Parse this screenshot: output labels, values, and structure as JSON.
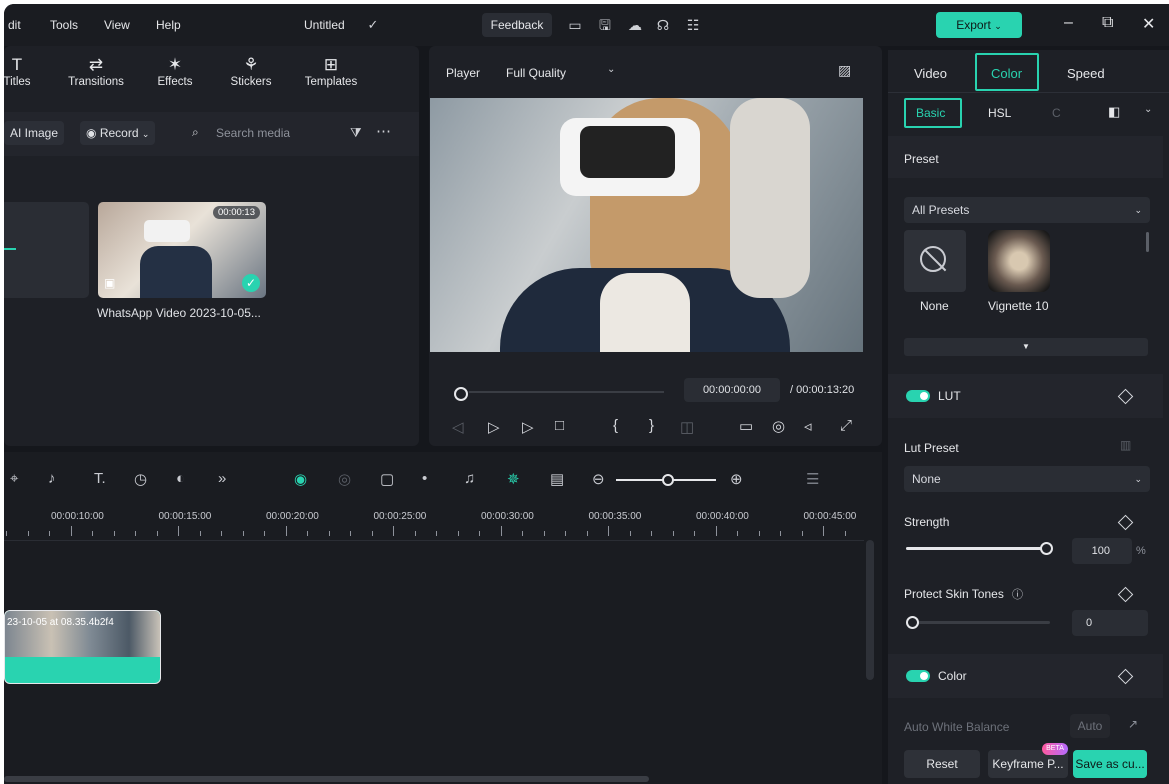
{
  "menu": {
    "edit": "dit",
    "tools": "Tools",
    "view": "View",
    "help": "Help",
    "title": "Untitled",
    "feedback": "Feedback",
    "export": "Export"
  },
  "toolbar": {
    "titles": "Titles",
    "transitions": "Transitions",
    "effects": "Effects",
    "stickers": "Stickers",
    "templates": "Templates"
  },
  "media": {
    "ai_image": "AI Image",
    "record": "Record",
    "search_placeholder": "Search media",
    "clip_name": "WhatsApp Video 2023-10-05...",
    "clip_duration": "00:00:13"
  },
  "player": {
    "label": "Player",
    "quality": "Full Quality",
    "current_time": "00:00:00:00",
    "total_time": "/ 00:00:13:20"
  },
  "timeline": {
    "ticks": [
      "00:00:10:00",
      "00:00:15:00",
      "00:00:20:00",
      "00:00:25:00",
      "00:00:30:00",
      "00:00:35:00",
      "00:00:40:00",
      "00:00:45:00"
    ],
    "clip_label": "23-10-05 at 08.35.4b2f4"
  },
  "right_panel": {
    "tabs": {
      "video": "Video",
      "color": "Color",
      "speed": "Speed"
    },
    "subtabs": {
      "basic": "Basic",
      "hsl": "HSL",
      "curves": "C"
    },
    "preset_title": "Preset",
    "all_presets": "All Presets",
    "preset_none": "None",
    "preset_vignette": "Vignette 10",
    "lut": "LUT",
    "lut_preset_label": "Lut Preset",
    "lut_preset_value": "None",
    "strength_label": "Strength",
    "strength_value": "100",
    "strength_unit": "%",
    "strength_level": 1.0,
    "protect_label": "Protect Skin Tones",
    "protect_value": "0",
    "color_label": "Color",
    "awb_label": "Auto White Balance",
    "auto_label": "Auto",
    "reset": "Reset",
    "keyframe": "Keyframe P...",
    "beta": "BETA",
    "save_as": "Save as cu..."
  },
  "colors": {
    "accent": "#29d3b0",
    "bg": "#15171c",
    "panel": "#1e2026"
  }
}
